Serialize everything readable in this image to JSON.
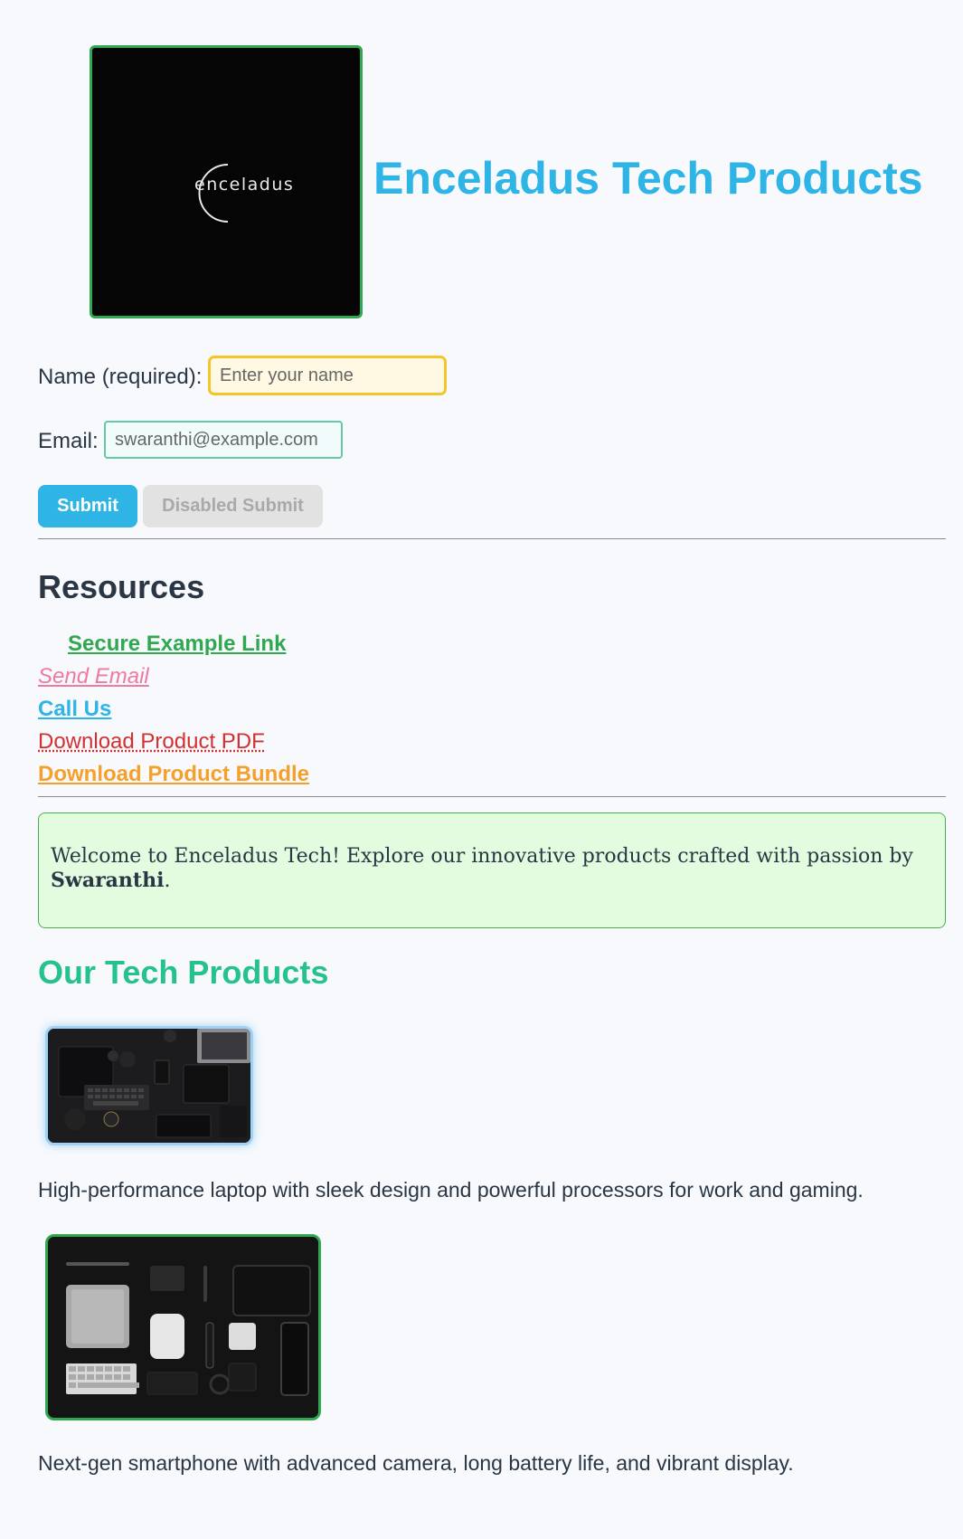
{
  "header": {
    "logo_text": "enceladus",
    "site_title": "Enceladus Tech Products"
  },
  "form": {
    "name_label": "Name (required):",
    "name_placeholder": "Enter your name",
    "email_label": "Email:",
    "email_placeholder": "swaranthi@example.com",
    "submit_label": "Submit",
    "disabled_submit_label": "Disabled Submit"
  },
  "resources": {
    "heading": "Resources",
    "links": [
      {
        "label": "Secure Example Link"
      },
      {
        "label": "Send Email"
      },
      {
        "label": "Call Us"
      },
      {
        "label": "Download Product PDF"
      },
      {
        "label": "Download Product Bundle"
      }
    ]
  },
  "welcome": {
    "text_before": "Welcome to Enceladus Tech! Explore our innovative products crafted with passion by ",
    "author": "Swaranthi",
    "text_after": "."
  },
  "products": {
    "heading": "Our Tech Products",
    "items": [
      {
        "image": "laptop-accessories-flatlay-image",
        "description": "High-performance laptop with sleek design and powerful processors for work and gaming."
      },
      {
        "image": "smartphone-gadgets-flatlay-image",
        "description": "Next-gen smartphone with advanced camera, long battery life, and vibrant display."
      }
    ]
  },
  "colors": {
    "title_blue": "#2fb4e6",
    "green": "#2fa84f",
    "teal": "#26c28d",
    "pink": "#ee7aa4",
    "red": "#d33030",
    "orange": "#f5a02b"
  }
}
